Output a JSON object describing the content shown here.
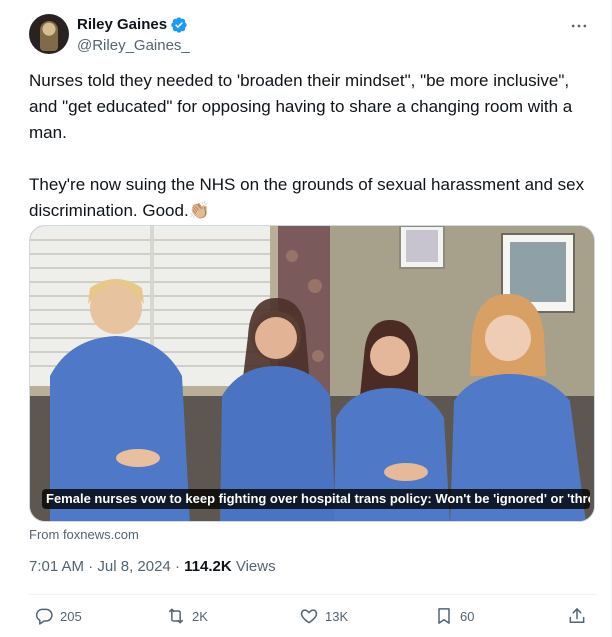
{
  "author": {
    "name": "Riley Gaines",
    "handle": "@Riley_Gaines_",
    "verified": true
  },
  "icons": {
    "verified": "verified-badge-icon",
    "more": "more-options-icon",
    "reply": "reply-icon",
    "retweet": "retweet-icon",
    "like": "like-icon",
    "bookmark": "bookmark-icon",
    "share": "share-icon"
  },
  "tweet": {
    "paragraph1": "Nurses told they needed to 'broaden their mindset\", \"be more inclusive\", and \"get educated\" for opposing having to share a changing room with a man.",
    "paragraph2": "They're now suing the NHS on the grounds of sexual harassment and sex discrimination. Good.👏🏼"
  },
  "card": {
    "caption": "Female nurses vow to keep fighting over hospital trans policy: Won't be 'ignored' or 'thre...",
    "source": "From foxnews.com"
  },
  "meta": {
    "time": "7:01 AM",
    "separator": " · ",
    "date": "Jul 8, 2024",
    "views_count": "114.2K",
    "views_label": " Views"
  },
  "actions": {
    "replies": "205",
    "retweets": "2K",
    "likes": "13K",
    "bookmarks": "60"
  },
  "colors": {
    "accent": "#1d9bf0",
    "text": "#0f1419",
    "secondary": "#536471",
    "scrubs": "#4f78c7"
  }
}
